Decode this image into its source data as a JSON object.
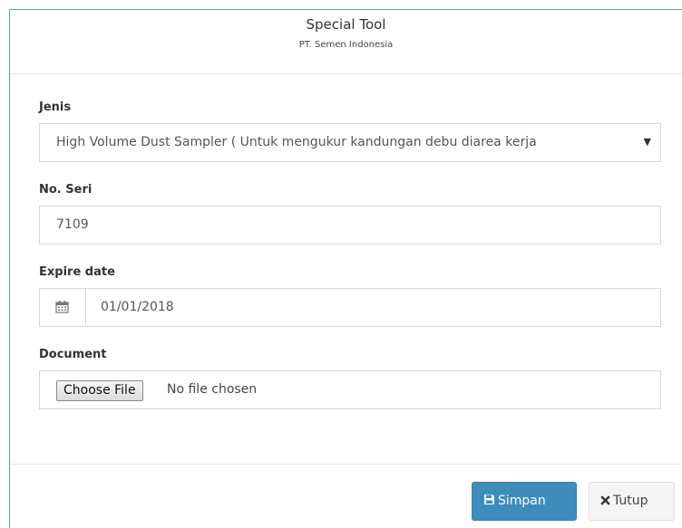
{
  "header": {
    "title": "Special Tool",
    "subtitle": "PT. Semen Indonesia"
  },
  "form": {
    "jenis": {
      "label": "Jenis",
      "value": "High Volume Dust Sampler ( Untuk mengukur kandungan debu diarea kerja"
    },
    "no_seri": {
      "label": "No. Seri",
      "value": "7109"
    },
    "expire_date": {
      "label": "Expire date",
      "value": "01/01/2018"
    },
    "document": {
      "label": "Document",
      "button_label": "Choose File",
      "status": "No file chosen"
    }
  },
  "footer": {
    "save_label": "Simpan",
    "close_label": "Tutup"
  },
  "colors": {
    "primary": "#3c8dbc",
    "border": "#d2d6de",
    "modal_edge": "#5b9bc9"
  },
  "icons": {
    "date": "calendar-icon",
    "save": "floppy-disk-icon",
    "close": "close-icon",
    "select": "caret-down-icon"
  }
}
